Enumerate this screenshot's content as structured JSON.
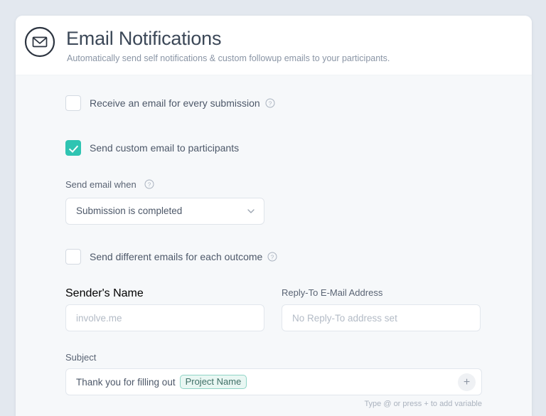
{
  "header": {
    "icon": "envelope-circle-icon",
    "title": "Email Notifications",
    "subtitle": "Automatically send self notifications & custom followup emails to your participants."
  },
  "options": [
    {
      "id": "receive-email-every-submission",
      "label": "Receive an email for every submission",
      "checked": false,
      "help": true
    },
    {
      "id": "send-custom-email-participants",
      "label": "Send custom email to participants",
      "checked": true,
      "help": false
    },
    {
      "id": "send-different-emails-each-outcome",
      "label": "Send different emails for each outcome",
      "checked": false,
      "help": true
    }
  ],
  "send_when": {
    "label": "Send email when",
    "help": true,
    "selected": "Submission is completed",
    "chevron": "chevron-down-icon"
  },
  "sender_name": {
    "label": "Sender's Name",
    "value": "",
    "placeholder": "involve.me"
  },
  "reply_to": {
    "label": "Reply-To E-Mail Address",
    "value": "",
    "placeholder": "No Reply-To address set"
  },
  "subject": {
    "label": "Subject",
    "text": "Thank you for filling out",
    "variable_chip": "Project Name",
    "add_variable_button": "+",
    "hint": "Type @ or press + to add variable"
  },
  "colors": {
    "accent": "#2fc4b2",
    "chip_border": "#8fd4c6",
    "chip_bg": "#e9f7f3",
    "page_bg": "#e3e8ef",
    "body_bg": "#f6f8fa"
  }
}
